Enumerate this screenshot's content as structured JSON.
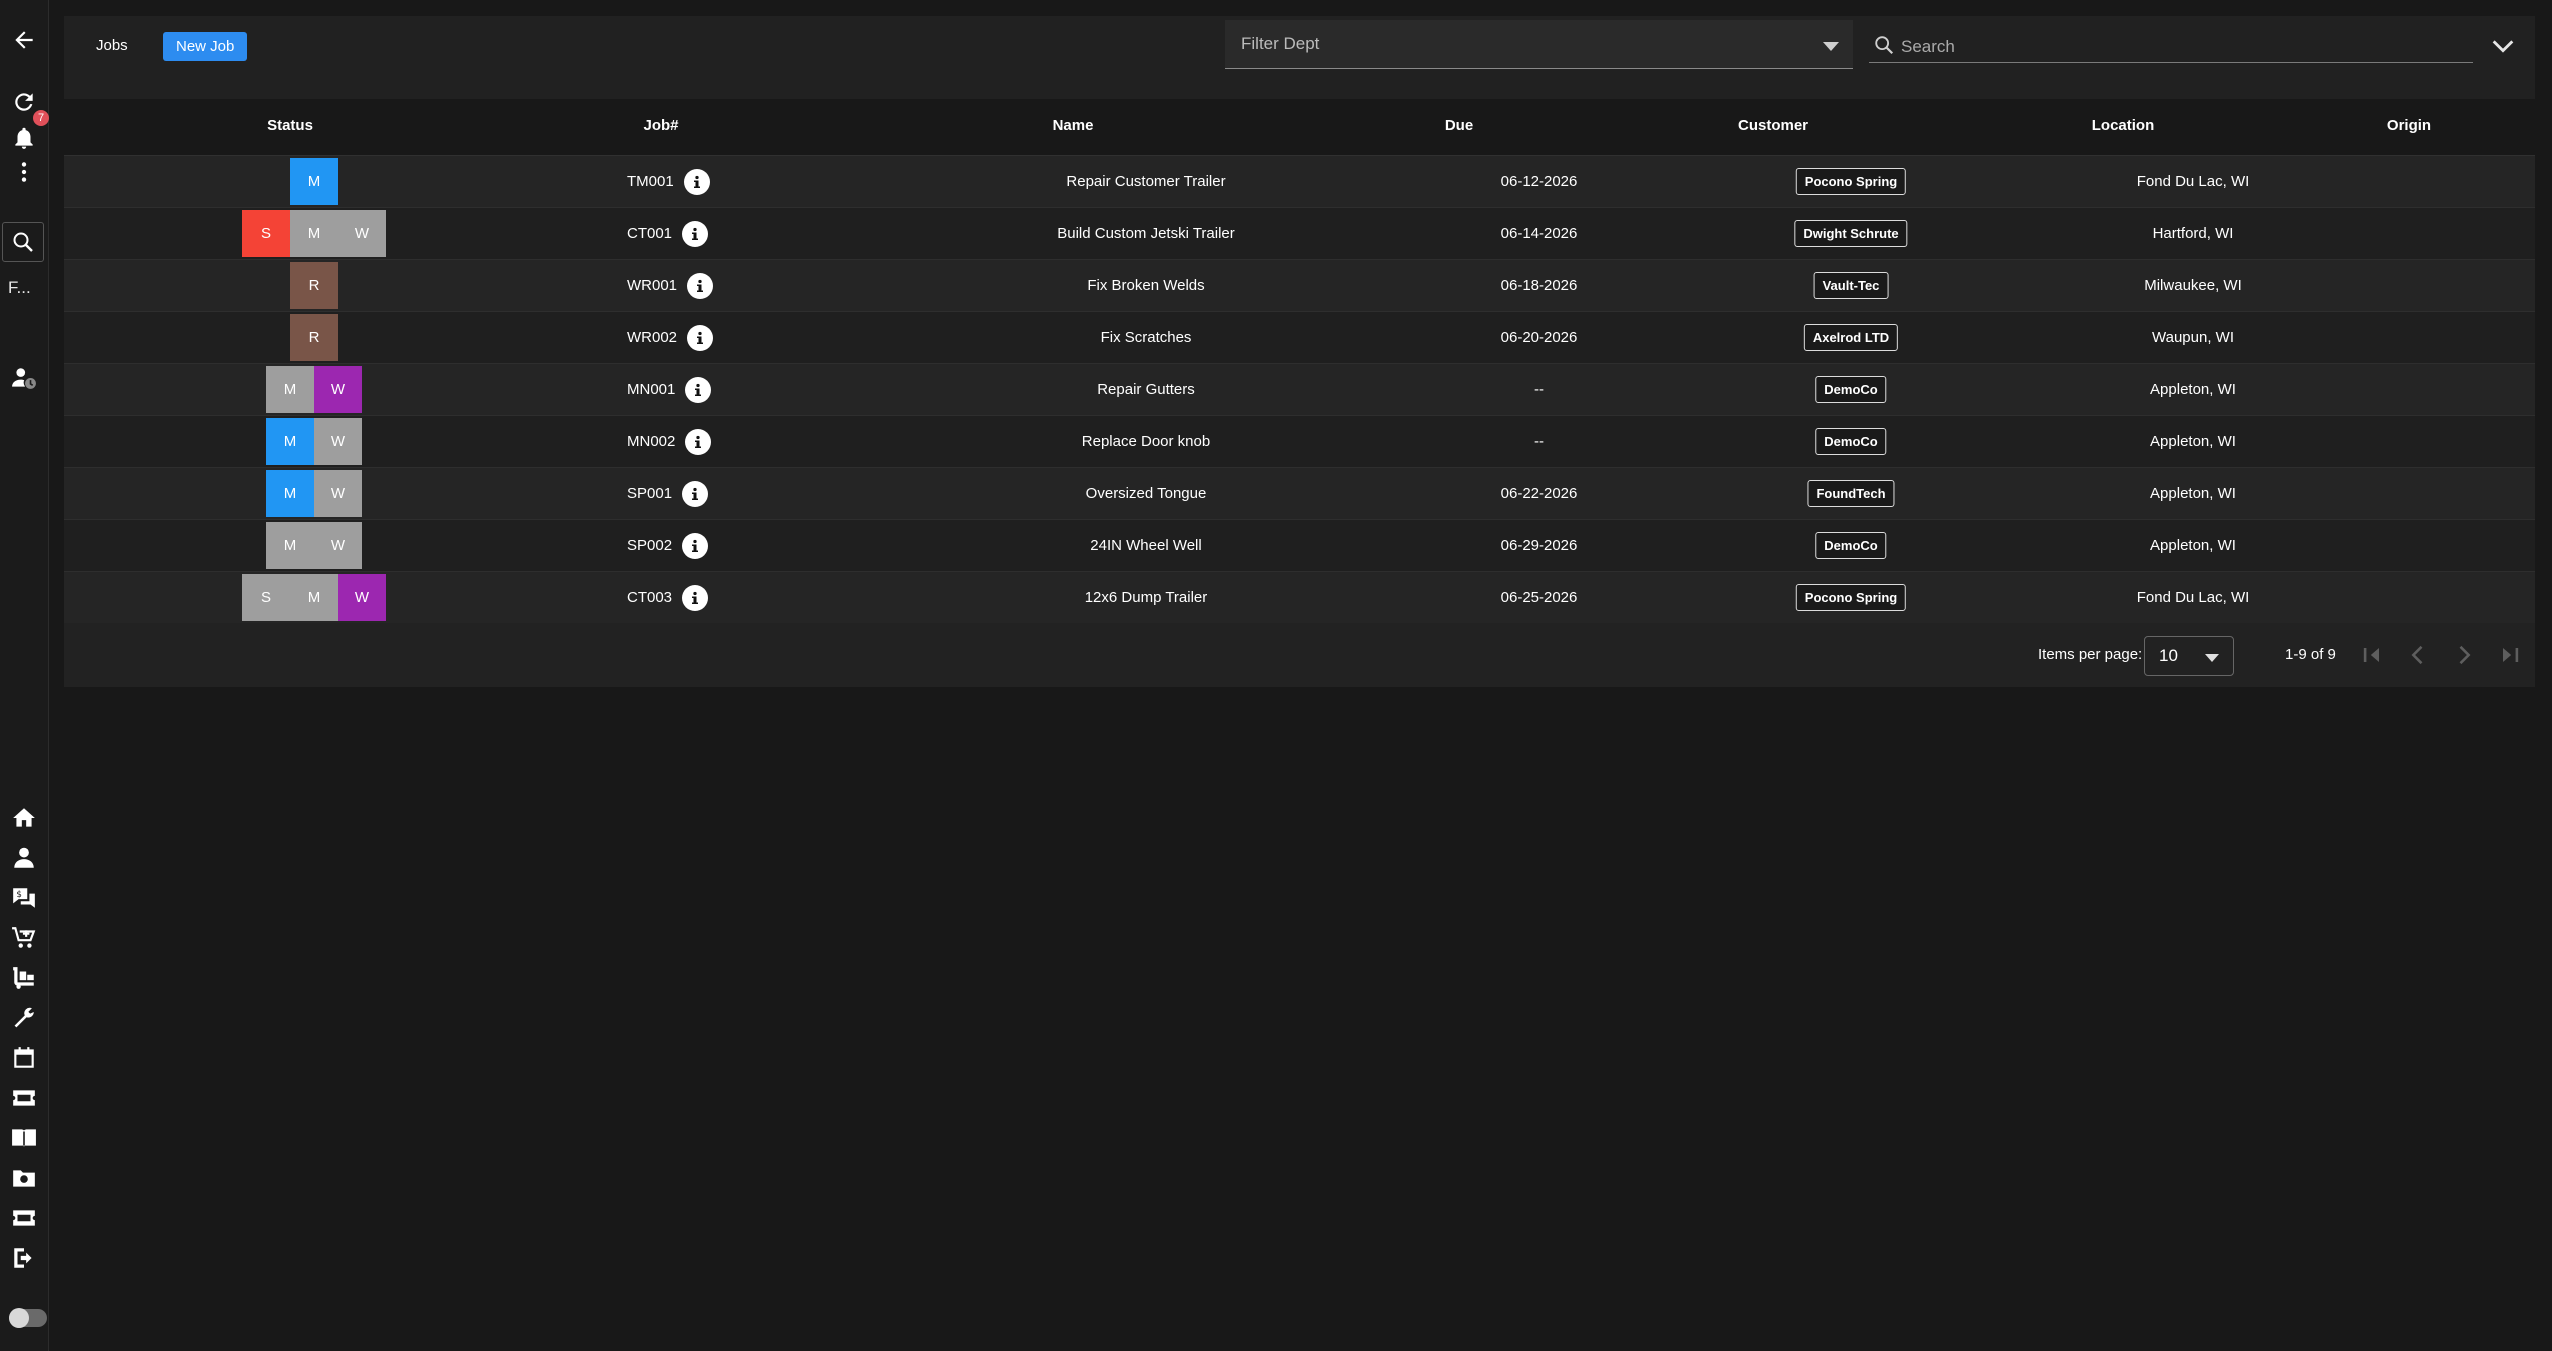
{
  "sidebar": {
    "notification_count": "7",
    "filter_text": "F...",
    "icons": [
      "arrow-left-icon",
      "refresh-icon",
      "bell-icon",
      "more-vert-icon",
      "search-icon",
      "user-clock-icon",
      "home-icon",
      "person-icon",
      "quote-icon",
      "cart-icon",
      "dolly-icon",
      "wrench-icon",
      "calendar-icon",
      "ticket-icon",
      "book-icon",
      "camera-folder-icon",
      "ticket-icon",
      "logout-icon",
      "theme-toggle"
    ]
  },
  "toolbar": {
    "jobs_label": "Jobs",
    "new_job_label": "New Job",
    "filter_dept_placeholder": "Filter Dept",
    "search_placeholder": "Search"
  },
  "table": {
    "headers": {
      "status": "Status",
      "job": "Job#",
      "name": "Name",
      "due": "Due",
      "customer": "Customer",
      "location": "Location",
      "origin": "Origin"
    },
    "rows": [
      {
        "status": [
          {
            "l": "M",
            "c": "#2196f3"
          }
        ],
        "job": "TM001",
        "name": "Repair Customer Trailer",
        "due": "06-12-2026",
        "customer": "Pocono Spring",
        "location": "Fond Du Lac, WI",
        "origin": ""
      },
      {
        "status": [
          {
            "l": "S",
            "c": "#f44336"
          },
          {
            "l": "M",
            "c": "#9e9e9e"
          },
          {
            "l": "W",
            "c": "#9e9e9e"
          }
        ],
        "job": "CT001",
        "name": "Build Custom Jetski Trailer",
        "due": "06-14-2026",
        "customer": "Dwight Schrute",
        "location": "Hartford, WI",
        "origin": ""
      },
      {
        "status": [
          {
            "l": "R",
            "c": "#795548"
          }
        ],
        "job": "WR001",
        "name": "Fix Broken Welds",
        "due": "06-18-2026",
        "customer": "Vault-Tec",
        "location": "Milwaukee, WI",
        "origin": ""
      },
      {
        "status": [
          {
            "l": "R",
            "c": "#795548"
          }
        ],
        "job": "WR002",
        "name": "Fix Scratches",
        "due": "06-20-2026",
        "customer": "Axelrod LTD",
        "location": "Waupun, WI",
        "origin": ""
      },
      {
        "status": [
          {
            "l": "M",
            "c": "#9e9e9e"
          },
          {
            "l": "W",
            "c": "#9c27b0"
          }
        ],
        "job": "MN001",
        "name": "Repair Gutters",
        "due": "--",
        "customer": "DemoCo",
        "location": "Appleton, WI",
        "origin": ""
      },
      {
        "status": [
          {
            "l": "M",
            "c": "#2196f3"
          },
          {
            "l": "W",
            "c": "#9e9e9e"
          }
        ],
        "job": "MN002",
        "name": "Replace Door knob",
        "due": "--",
        "customer": "DemoCo",
        "location": "Appleton, WI",
        "origin": ""
      },
      {
        "status": [
          {
            "l": "M",
            "c": "#2196f3"
          },
          {
            "l": "W",
            "c": "#9e9e9e"
          }
        ],
        "job": "SP001",
        "name": "Oversized Tongue",
        "due": "06-22-2026",
        "customer": "FoundTech",
        "location": "Appleton, WI",
        "origin": ""
      },
      {
        "status": [
          {
            "l": "M",
            "c": "#9e9e9e"
          },
          {
            "l": "W",
            "c": "#9e9e9e"
          }
        ],
        "job": "SP002",
        "name": "24IN Wheel Well",
        "due": "06-29-2026",
        "customer": "DemoCo",
        "location": "Appleton, WI",
        "origin": ""
      },
      {
        "status": [
          {
            "l": "S",
            "c": "#9e9e9e"
          },
          {
            "l": "M",
            "c": "#9e9e9e"
          },
          {
            "l": "W",
            "c": "#9c27b0"
          }
        ],
        "job": "CT003",
        "name": "12x6 Dump Trailer",
        "due": "06-25-2026",
        "customer": "Pocono Spring",
        "location": "Fond Du Lac, WI",
        "origin": ""
      }
    ]
  },
  "paginator": {
    "items_per_page_label": "Items per page:",
    "items_per_page_value": "10",
    "range_label": "1-9 of 9"
  }
}
